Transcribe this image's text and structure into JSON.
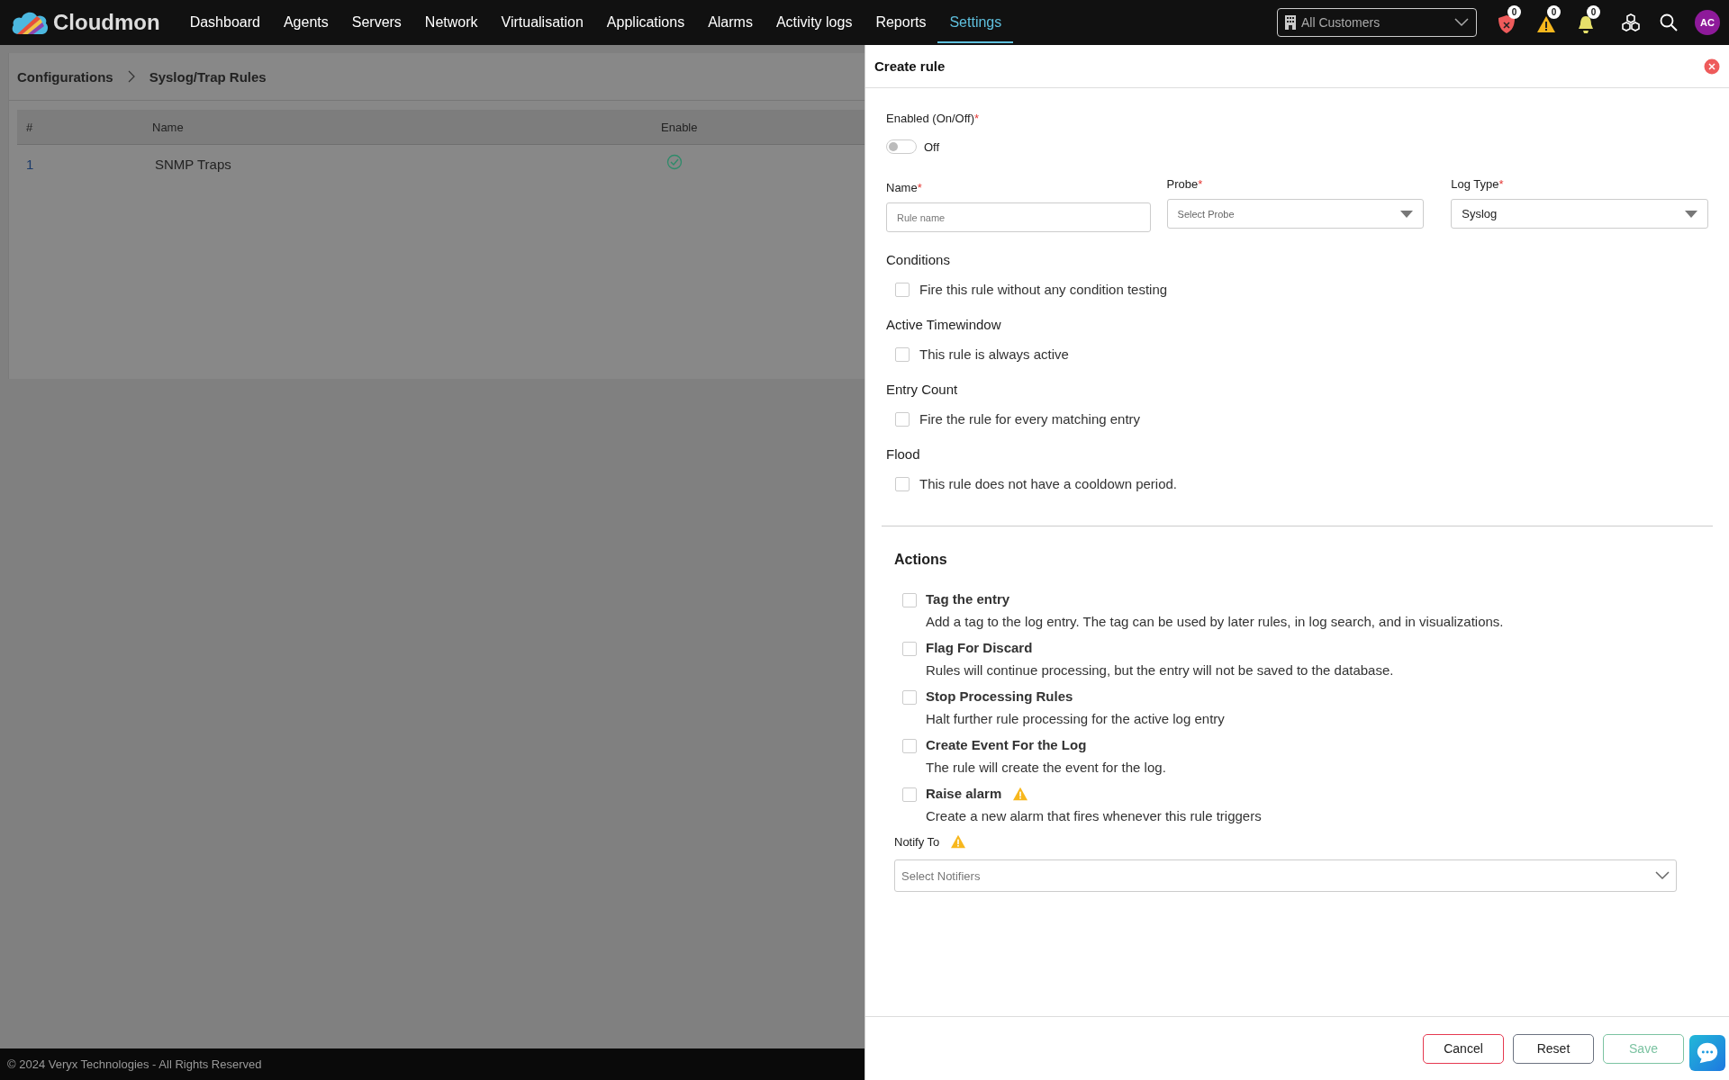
{
  "brand": {
    "name": "Cloudmon"
  },
  "nav": [
    {
      "label": "Dashboard",
      "selected": false
    },
    {
      "label": "Agents",
      "selected": false
    },
    {
      "label": "Servers",
      "selected": false
    },
    {
      "label": "Network",
      "selected": false
    },
    {
      "label": "Virtualisation",
      "selected": false
    },
    {
      "label": "Applications",
      "selected": false
    },
    {
      "label": "Alarms",
      "selected": false
    },
    {
      "label": "Activity logs",
      "selected": false
    },
    {
      "label": "Reports",
      "selected": false
    },
    {
      "label": "Settings",
      "selected": true
    }
  ],
  "customer_select": {
    "value": "All Customers"
  },
  "header_icons": [
    {
      "kind": "shield",
      "count": "0"
    },
    {
      "kind": "warning",
      "count": "0"
    },
    {
      "kind": "bell",
      "count": "0"
    }
  ],
  "avatar": {
    "initials": "AC"
  },
  "breadcrumb": [
    "Configurations",
    "Syslog/Trap Rules"
  ],
  "table": {
    "columns": [
      "#",
      "Name",
      "Enable"
    ],
    "rows": [
      {
        "index": "1",
        "name": "SNMP Traps",
        "enabled": true
      }
    ]
  },
  "footer": {
    "text": "© 2024 Veryx Technologies - All Rights Reserved"
  },
  "dialog": {
    "title": "Create rule",
    "enabled_field": {
      "label": "Enabled (On/Off)",
      "required_mark": "*",
      "on": false,
      "state_label": "Off"
    },
    "fields": [
      {
        "label": "Name",
        "required_mark": "*",
        "kind": "text",
        "placeholder": "Rule name"
      },
      {
        "label": "Probe",
        "required_mark": "*",
        "kind": "select",
        "placeholder": "Select Probe"
      },
      {
        "label": "Log Type",
        "required_mark": "*",
        "kind": "select",
        "value": "Syslog"
      }
    ],
    "sections": [
      {
        "title": "Conditions",
        "option": {
          "label": "Fire this rule without any condition testing",
          "checked": false
        }
      },
      {
        "title": "Active Timewindow",
        "option": {
          "label": "This rule is always active",
          "checked": false
        }
      },
      {
        "title": "Entry Count",
        "option": {
          "label": "Fire the rule for every matching entry",
          "checked": false
        }
      },
      {
        "title": "Flood",
        "option": {
          "label": "This rule does not have a cooldown period.",
          "checked": false
        }
      }
    ],
    "actions_title": "Actions",
    "actions": [
      {
        "label": "Tag the entry",
        "description": "Add a tag to the log entry. The tag can be used by later rules, in log search, and in visualizations.",
        "checked": false,
        "warning": false
      },
      {
        "label": "Flag For Discard",
        "description": "Rules will continue processing, but the entry will not be saved to the database.",
        "checked": false,
        "warning": false
      },
      {
        "label": "Stop Processing Rules",
        "description": "Halt further rule processing for the active log entry",
        "checked": false,
        "warning": false
      },
      {
        "label": "Create Event For the Log",
        "description": "The rule will create the event for the log.",
        "checked": false,
        "warning": false
      },
      {
        "label": "Raise alarm",
        "description": "Create a new alarm that fires whenever this rule triggers",
        "checked": false,
        "warning": true
      }
    ],
    "notify": {
      "label": "Notify To",
      "warning": true,
      "placeholder": "Select Notifiers"
    },
    "buttons": [
      {
        "label": "Cancel",
        "kind": "cancel"
      },
      {
        "label": "Reset",
        "kind": "reset"
      },
      {
        "label": "Save",
        "kind": "save"
      }
    ]
  }
}
